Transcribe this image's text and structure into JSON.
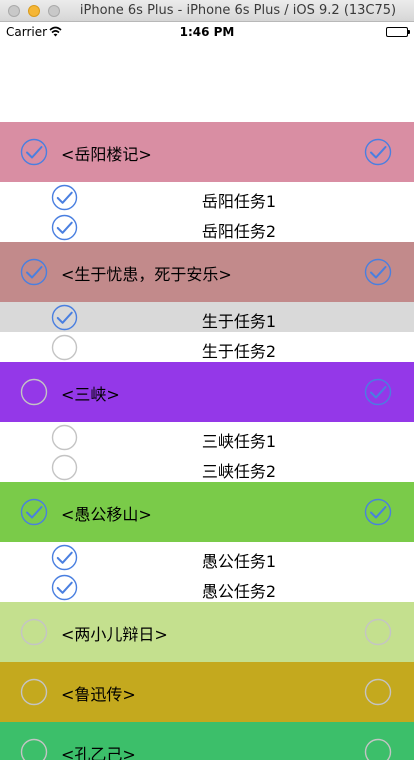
{
  "window": {
    "title": "iPhone 6s Plus - iPhone 6s Plus / iOS 9.2 (13C75)"
  },
  "status_bar": {
    "carrier": "Carrier",
    "time": "1:46 PM"
  },
  "colors": {
    "check_blue": "#4a7fe0",
    "check_gray": "#c4c4c4",
    "selected_row": "#d9d9d9"
  },
  "sections": [
    {
      "title": "<岳阳楼记>",
      "bg": "#d98ea3",
      "checked": true,
      "right_checked": true,
      "tasks": [
        {
          "label": "岳阳任务1",
          "checked": true,
          "selected": false
        },
        {
          "label": "岳阳任务2",
          "checked": true,
          "selected": false
        }
      ]
    },
    {
      "title": "<生于忧患，死于安乐>",
      "bg": "#c28a8b",
      "checked": true,
      "right_checked": true,
      "tasks": [
        {
          "label": "生于任务1",
          "checked": true,
          "selected": true
        },
        {
          "label": "生于任务2",
          "checked": false,
          "selected": false
        }
      ]
    },
    {
      "title": "<三峡>",
      "bg": "#9438e8",
      "checked": false,
      "right_checked": true,
      "tasks": [
        {
          "label": "三峡任务1",
          "checked": false,
          "selected": false
        },
        {
          "label": "三峡任务2",
          "checked": false,
          "selected": false
        }
      ]
    },
    {
      "title": "<愚公移山>",
      "bg": "#7acb49",
      "checked": true,
      "right_checked": true,
      "tasks": [
        {
          "label": "愚公任务1",
          "checked": true,
          "selected": false
        },
        {
          "label": "愚公任务2",
          "checked": true,
          "selected": false
        }
      ]
    },
    {
      "title": "<两小儿辩日>",
      "bg": "#c4e08e",
      "checked": false,
      "right_checked": false,
      "tasks": []
    },
    {
      "title": "<鲁迅传>",
      "bg": "#c4a91e",
      "checked": false,
      "right_checked": false,
      "tasks": []
    },
    {
      "title": "<孔乙己>",
      "bg": "#3cbf6a",
      "checked": false,
      "right_checked": false,
      "tasks": []
    }
  ]
}
